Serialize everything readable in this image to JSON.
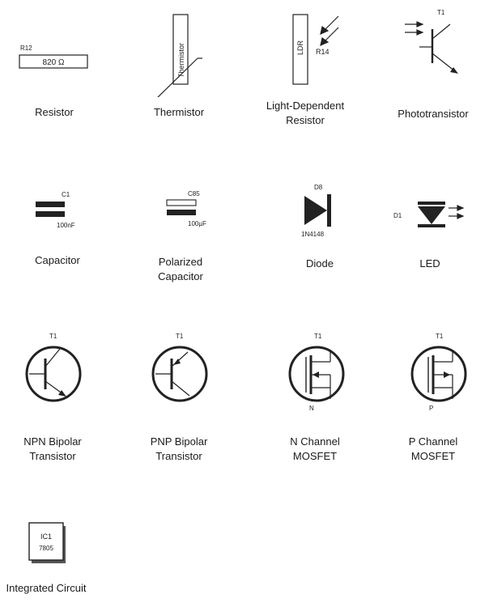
{
  "components": [
    {
      "id": "resistor",
      "ref": "R12",
      "value": "820 Ω",
      "caption": [
        "Resistor"
      ]
    },
    {
      "id": "thermistor",
      "symbol_text": "Thermistor",
      "caption": [
        "Thermistor"
      ]
    },
    {
      "id": "ldr",
      "symbol_text": "LDR",
      "ref": "R14",
      "caption": [
        "Light-Dependent",
        "Resistor"
      ]
    },
    {
      "id": "phototransistor",
      "ref": "T1",
      "caption": [
        "Phototransistor"
      ]
    },
    {
      "id": "capacitor",
      "ref": "C1",
      "value": "100nF",
      "caption": [
        "Capacitor"
      ]
    },
    {
      "id": "polarized-capacitor",
      "ref": "C85",
      "value": "100µF",
      "caption": [
        "Polarized",
        "Capacitor"
      ]
    },
    {
      "id": "diode",
      "ref": "D8",
      "value": "1N4148",
      "caption": [
        "Diode"
      ]
    },
    {
      "id": "led",
      "ref": "D1",
      "caption": [
        "LED"
      ]
    },
    {
      "id": "npn",
      "ref": "T1",
      "caption": [
        "NPN Bipolar",
        "Transistor"
      ]
    },
    {
      "id": "pnp",
      "ref": "T1",
      "caption": [
        "PNP Bipolar",
        "Transistor"
      ]
    },
    {
      "id": "nmos",
      "ref": "T1",
      "pin_label": "N",
      "caption": [
        "N Channel",
        "MOSFET"
      ]
    },
    {
      "id": "pmos",
      "ref": "T1",
      "pin_label": "P",
      "caption": [
        "P Channel",
        "MOSFET"
      ]
    },
    {
      "id": "ic",
      "ref": "IC1",
      "value": "7805",
      "caption": [
        "Integrated Circuit"
      ]
    }
  ]
}
